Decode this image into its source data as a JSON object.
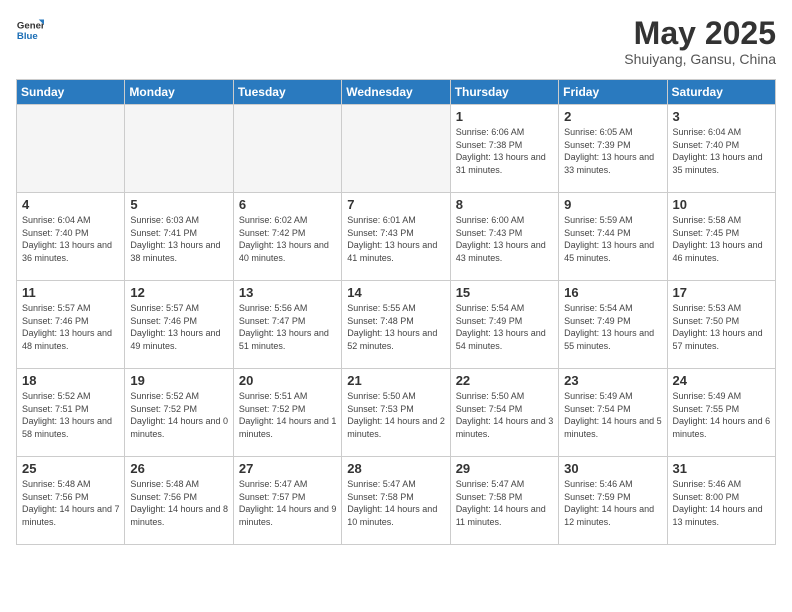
{
  "header": {
    "logo_general": "General",
    "logo_blue": "Blue",
    "title": "May 2025",
    "subtitle": "Shuiyang, Gansu, China"
  },
  "days_of_week": [
    "Sunday",
    "Monday",
    "Tuesday",
    "Wednesday",
    "Thursday",
    "Friday",
    "Saturday"
  ],
  "weeks": [
    [
      {
        "day": "",
        "empty": true
      },
      {
        "day": "",
        "empty": true
      },
      {
        "day": "",
        "empty": true
      },
      {
        "day": "",
        "empty": true
      },
      {
        "day": "1",
        "sunrise": "6:06 AM",
        "sunset": "7:38 PM",
        "daylight": "13 hours and 31 minutes."
      },
      {
        "day": "2",
        "sunrise": "6:05 AM",
        "sunset": "7:39 PM",
        "daylight": "13 hours and 33 minutes."
      },
      {
        "day": "3",
        "sunrise": "6:04 AM",
        "sunset": "7:40 PM",
        "daylight": "13 hours and 35 minutes."
      }
    ],
    [
      {
        "day": "4",
        "sunrise": "6:04 AM",
        "sunset": "7:40 PM",
        "daylight": "13 hours and 36 minutes."
      },
      {
        "day": "5",
        "sunrise": "6:03 AM",
        "sunset": "7:41 PM",
        "daylight": "13 hours and 38 minutes."
      },
      {
        "day": "6",
        "sunrise": "6:02 AM",
        "sunset": "7:42 PM",
        "daylight": "13 hours and 40 minutes."
      },
      {
        "day": "7",
        "sunrise": "6:01 AM",
        "sunset": "7:43 PM",
        "daylight": "13 hours and 41 minutes."
      },
      {
        "day": "8",
        "sunrise": "6:00 AM",
        "sunset": "7:43 PM",
        "daylight": "13 hours and 43 minutes."
      },
      {
        "day": "9",
        "sunrise": "5:59 AM",
        "sunset": "7:44 PM",
        "daylight": "13 hours and 45 minutes."
      },
      {
        "day": "10",
        "sunrise": "5:58 AM",
        "sunset": "7:45 PM",
        "daylight": "13 hours and 46 minutes."
      }
    ],
    [
      {
        "day": "11",
        "sunrise": "5:57 AM",
        "sunset": "7:46 PM",
        "daylight": "13 hours and 48 minutes."
      },
      {
        "day": "12",
        "sunrise": "5:57 AM",
        "sunset": "7:46 PM",
        "daylight": "13 hours and 49 minutes."
      },
      {
        "day": "13",
        "sunrise": "5:56 AM",
        "sunset": "7:47 PM",
        "daylight": "13 hours and 51 minutes."
      },
      {
        "day": "14",
        "sunrise": "5:55 AM",
        "sunset": "7:48 PM",
        "daylight": "13 hours and 52 minutes."
      },
      {
        "day": "15",
        "sunrise": "5:54 AM",
        "sunset": "7:49 PM",
        "daylight": "13 hours and 54 minutes."
      },
      {
        "day": "16",
        "sunrise": "5:54 AM",
        "sunset": "7:49 PM",
        "daylight": "13 hours and 55 minutes."
      },
      {
        "day": "17",
        "sunrise": "5:53 AM",
        "sunset": "7:50 PM",
        "daylight": "13 hours and 57 minutes."
      }
    ],
    [
      {
        "day": "18",
        "sunrise": "5:52 AM",
        "sunset": "7:51 PM",
        "daylight": "13 hours and 58 minutes."
      },
      {
        "day": "19",
        "sunrise": "5:52 AM",
        "sunset": "7:52 PM",
        "daylight": "14 hours and 0 minutes."
      },
      {
        "day": "20",
        "sunrise": "5:51 AM",
        "sunset": "7:52 PM",
        "daylight": "14 hours and 1 minutes."
      },
      {
        "day": "21",
        "sunrise": "5:50 AM",
        "sunset": "7:53 PM",
        "daylight": "14 hours and 2 minutes."
      },
      {
        "day": "22",
        "sunrise": "5:50 AM",
        "sunset": "7:54 PM",
        "daylight": "14 hours and 3 minutes."
      },
      {
        "day": "23",
        "sunrise": "5:49 AM",
        "sunset": "7:54 PM",
        "daylight": "14 hours and 5 minutes."
      },
      {
        "day": "24",
        "sunrise": "5:49 AM",
        "sunset": "7:55 PM",
        "daylight": "14 hours and 6 minutes."
      }
    ],
    [
      {
        "day": "25",
        "sunrise": "5:48 AM",
        "sunset": "7:56 PM",
        "daylight": "14 hours and 7 minutes."
      },
      {
        "day": "26",
        "sunrise": "5:48 AM",
        "sunset": "7:56 PM",
        "daylight": "14 hours and 8 minutes."
      },
      {
        "day": "27",
        "sunrise": "5:47 AM",
        "sunset": "7:57 PM",
        "daylight": "14 hours and 9 minutes."
      },
      {
        "day": "28",
        "sunrise": "5:47 AM",
        "sunset": "7:58 PM",
        "daylight": "14 hours and 10 minutes."
      },
      {
        "day": "29",
        "sunrise": "5:47 AM",
        "sunset": "7:58 PM",
        "daylight": "14 hours and 11 minutes."
      },
      {
        "day": "30",
        "sunrise": "5:46 AM",
        "sunset": "7:59 PM",
        "daylight": "14 hours and 12 minutes."
      },
      {
        "day": "31",
        "sunrise": "5:46 AM",
        "sunset": "8:00 PM",
        "daylight": "14 hours and 13 minutes."
      }
    ]
  ]
}
